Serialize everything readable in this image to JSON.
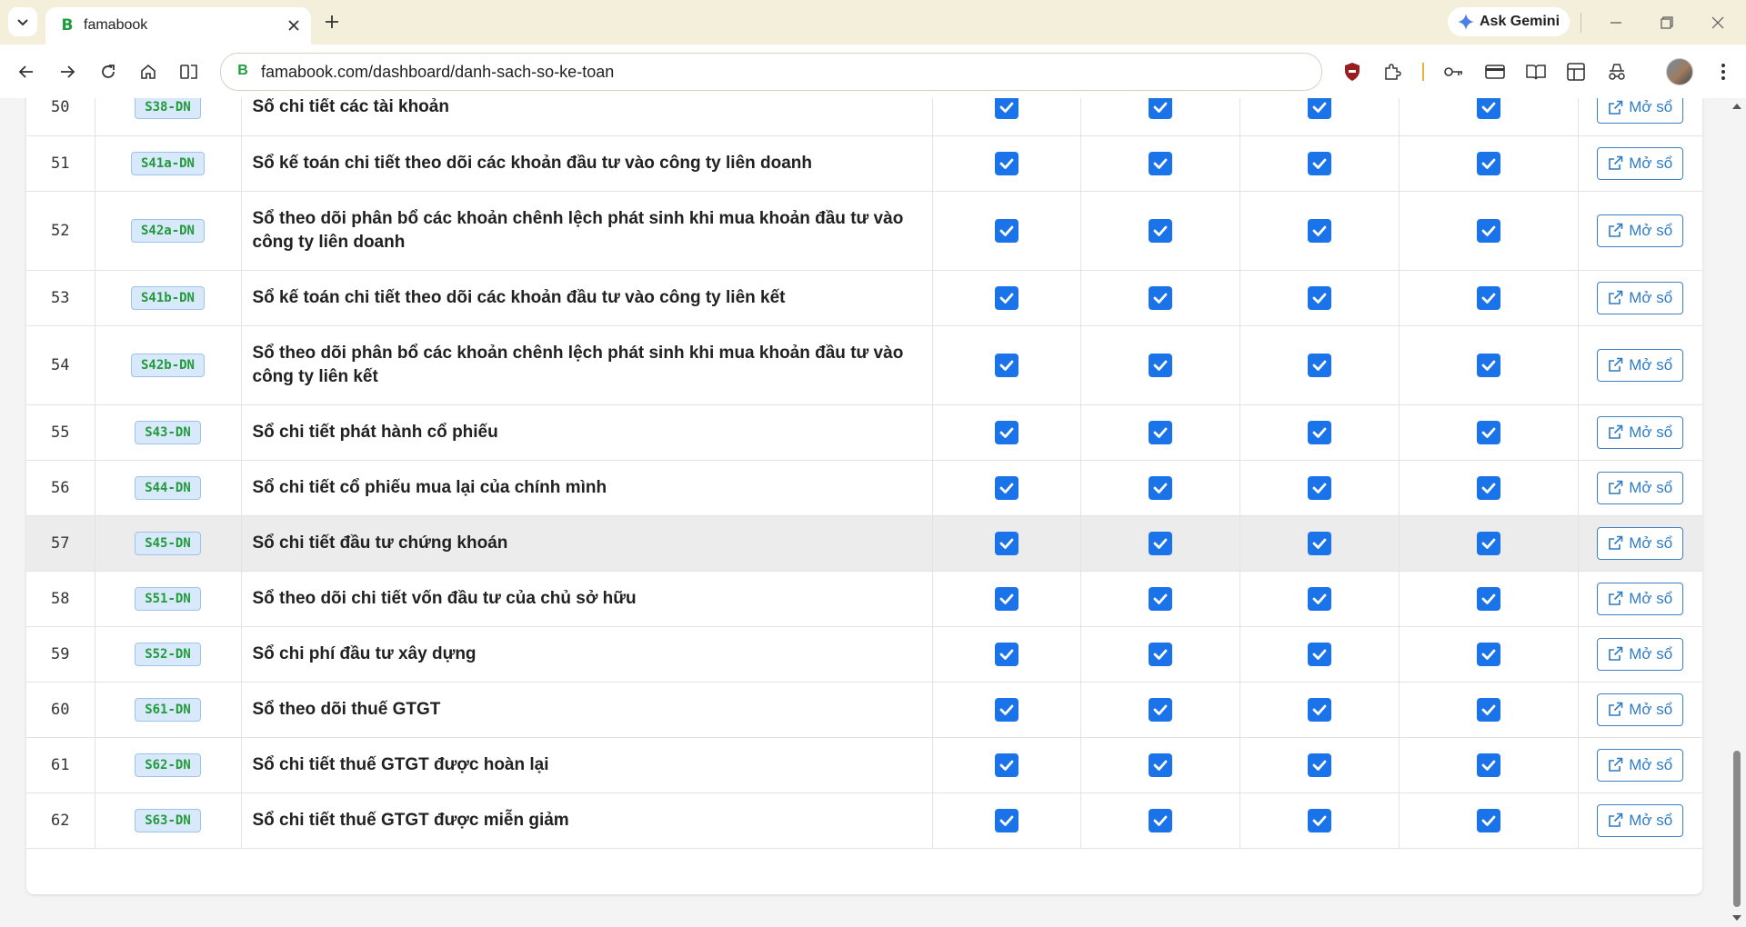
{
  "browser": {
    "tab": {
      "title": "famabook",
      "favicon": "B"
    },
    "gemini_label": "Ask Gemini",
    "omnibox": {
      "favicon": "B",
      "url": "famabook.com/dashboard/danh-sach-so-ke-toan"
    }
  },
  "table": {
    "open_label": "Mở sổ",
    "check_color": "#1a73e8",
    "rows": [
      {
        "num": "50",
        "code": "S38-DN",
        "name": "Sổ chi tiết các tài khoản"
      },
      {
        "num": "51",
        "code": "S41a-DN",
        "name": "Sổ kế toán chi tiết theo dõi các khoản đầu tư vào công ty liên doanh"
      },
      {
        "num": "52",
        "code": "S42a-DN",
        "name": "Sổ theo dõi phân bổ các khoản chênh lệch phát sinh khi mua khoản đầu tư vào công ty liên doanh"
      },
      {
        "num": "53",
        "code": "S41b-DN",
        "name": "Sổ kế toán chi tiết theo dõi các khoản đầu tư vào công ty liên kết"
      },
      {
        "num": "54",
        "code": "S42b-DN",
        "name": "Sổ theo dõi phân bổ các khoản chênh lệch phát sinh khi mua khoản đầu tư vào công ty liên kết"
      },
      {
        "num": "55",
        "code": "S43-DN",
        "name": "Sổ chi tiết phát hành cổ phiếu"
      },
      {
        "num": "56",
        "code": "S44-DN",
        "name": "Sổ chi tiết cổ phiếu mua lại của chính mình"
      },
      {
        "num": "57",
        "code": "S45-DN",
        "name": "Sổ chi tiết đầu tư chứng khoán"
      },
      {
        "num": "58",
        "code": "S51-DN",
        "name": "Sổ theo dõi chi tiết vốn đầu tư của chủ sở hữu"
      },
      {
        "num": "59",
        "code": "S52-DN",
        "name": "Sổ chi phí đầu tư xây dựng"
      },
      {
        "num": "60",
        "code": "S61-DN",
        "name": "Sổ theo dõi thuế GTGT"
      },
      {
        "num": "61",
        "code": "S62-DN",
        "name": "Sổ chi tiết thuế GTGT được hoàn lại"
      },
      {
        "num": "62",
        "code": "S63-DN",
        "name": "Sổ chi tiết thuế GTGT được miễn giảm"
      }
    ]
  }
}
